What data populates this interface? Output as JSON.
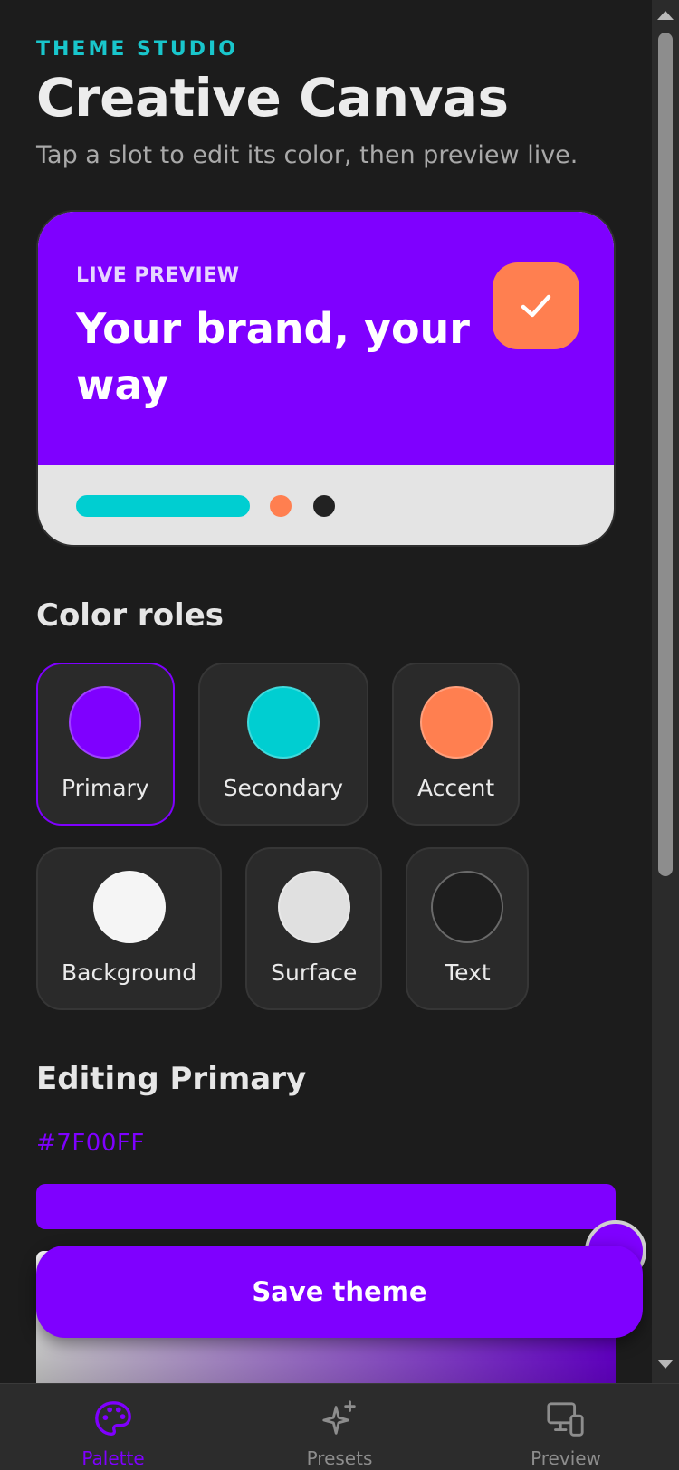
{
  "header": {
    "eyebrow": "THEME STUDIO",
    "title": "Creative Canvas",
    "subtitle": "Tap a slot to edit its color, then preview live."
  },
  "preview": {
    "eyebrow": "LIVE PREVIEW",
    "heading": "Your brand, your way",
    "check_icon": "check-icon"
  },
  "roles": {
    "heading": "Color roles",
    "items": [
      {
        "label": "Primary",
        "color": "#7F00FF",
        "selected": true
      },
      {
        "label": "Secondary",
        "color": "#00CED1",
        "selected": false
      },
      {
        "label": "Accent",
        "color": "#FF7F50",
        "selected": false
      },
      {
        "label": "Background",
        "color": "#F5F5F5",
        "selected": false
      },
      {
        "label": "Surface",
        "color": "#E0E0E0",
        "selected": false
      },
      {
        "label": "Text",
        "color": "#1E1E1E",
        "selected": false
      }
    ]
  },
  "editor": {
    "heading": "Editing Primary",
    "hex": "#7F00FF"
  },
  "actions": {
    "save_label": "Save theme"
  },
  "tabs": [
    {
      "label": "Palette",
      "icon": "palette-icon",
      "active": true
    },
    {
      "label": "Presets",
      "icon": "sparkles-icon",
      "active": false
    },
    {
      "label": "Preview",
      "icon": "devices-icon",
      "active": false
    }
  ],
  "colors": {
    "primary": "#7F00FF",
    "secondary": "#00CED1",
    "accent": "#FF7F50",
    "app_background": "#1C1C1C",
    "card_background": "#2A2A2A",
    "eyebrow": "#19C6CC"
  }
}
